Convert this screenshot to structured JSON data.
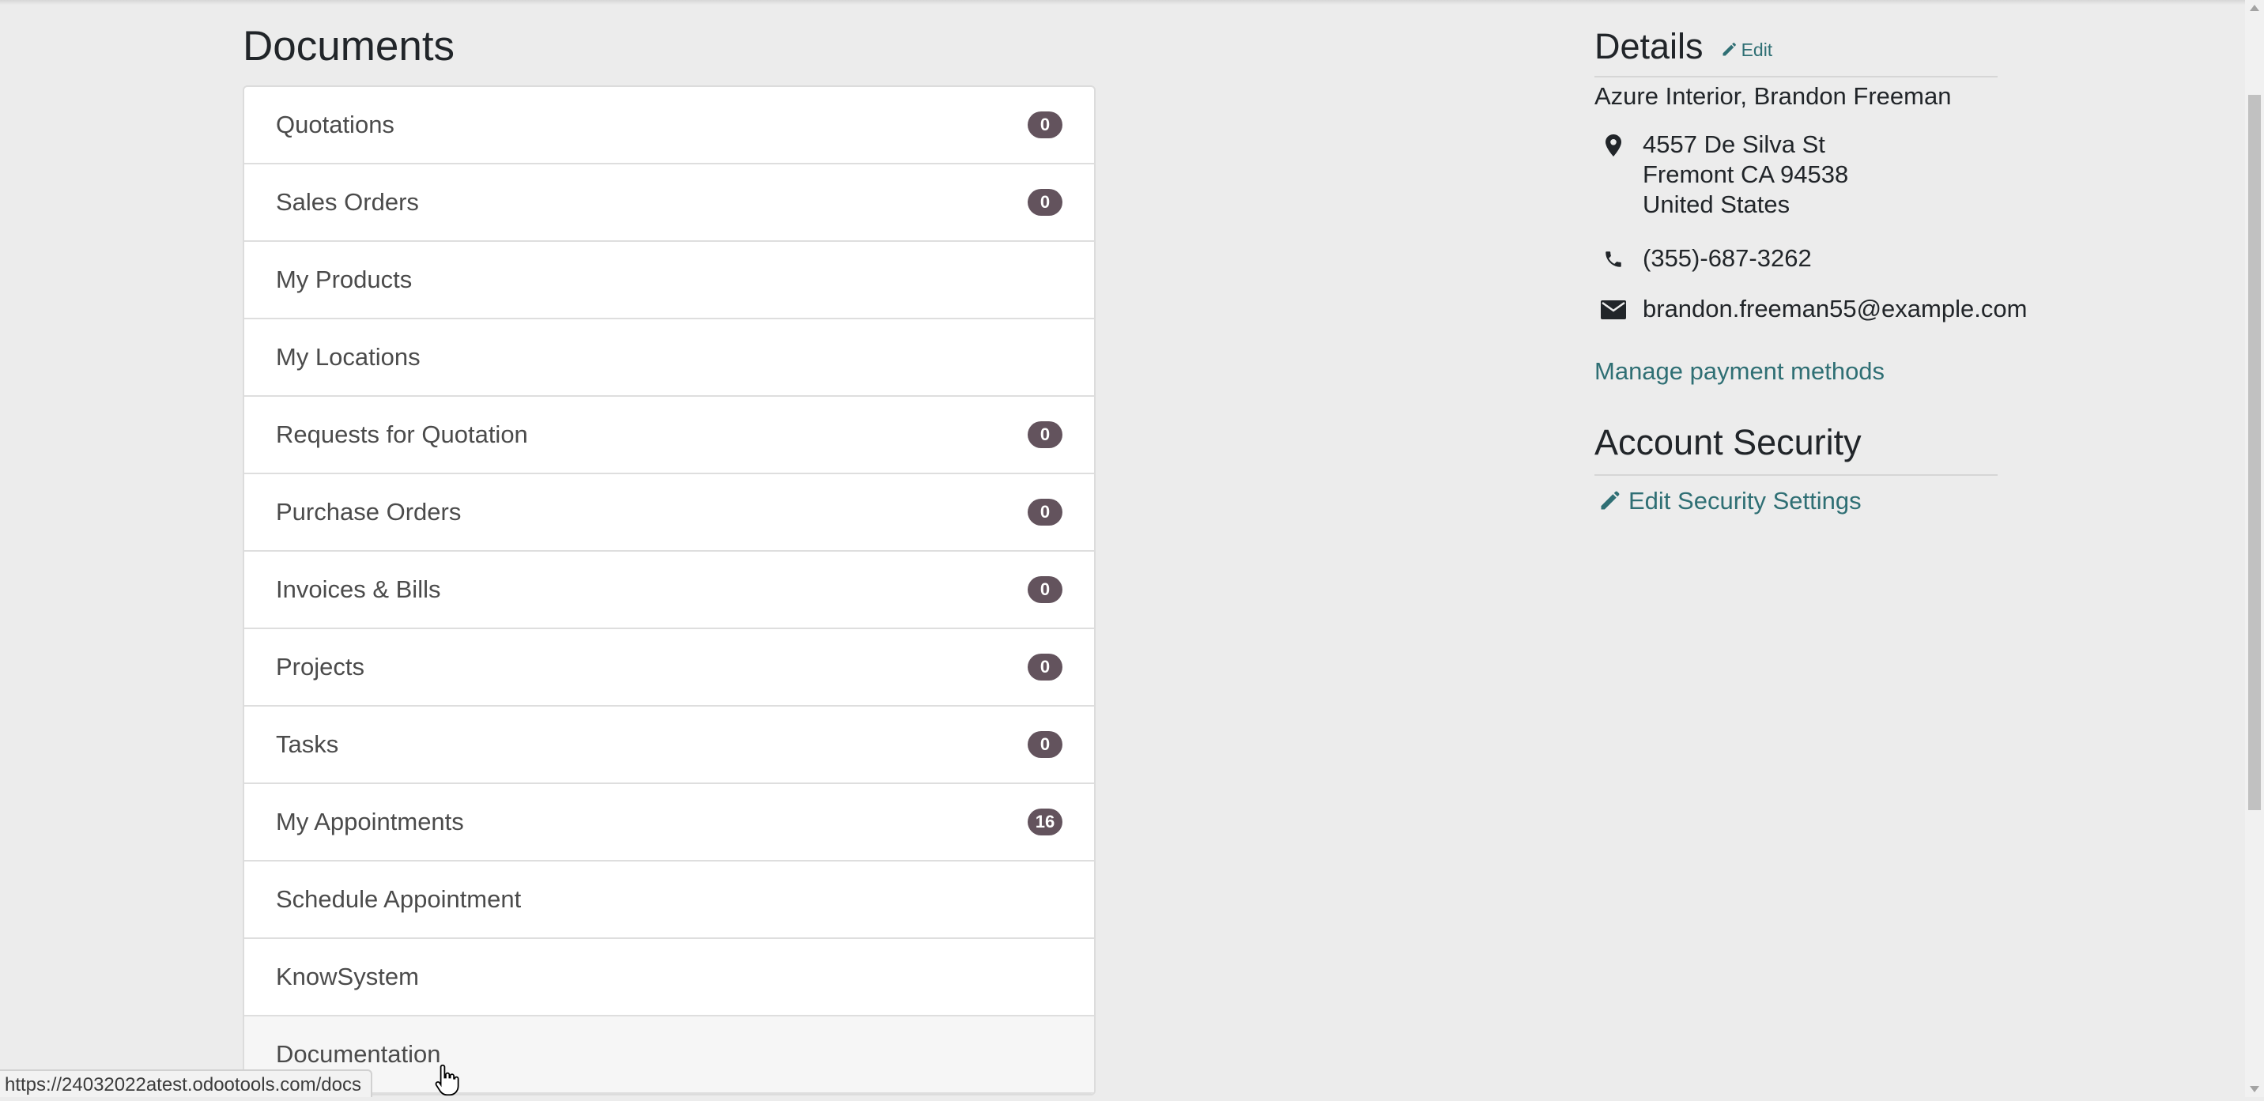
{
  "documents": {
    "title": "Documents",
    "items": [
      {
        "label": "Quotations",
        "badge": "0"
      },
      {
        "label": "Sales Orders",
        "badge": "0"
      },
      {
        "label": "My Products",
        "badge": null
      },
      {
        "label": "My Locations",
        "badge": null
      },
      {
        "label": "Requests for Quotation",
        "badge": "0"
      },
      {
        "label": "Purchase Orders",
        "badge": "0"
      },
      {
        "label": "Invoices & Bills",
        "badge": "0"
      },
      {
        "label": "Projects",
        "badge": "0"
      },
      {
        "label": "Tasks",
        "badge": "0"
      },
      {
        "label": "My Appointments",
        "badge": "16"
      },
      {
        "label": "Schedule Appointment",
        "badge": null
      },
      {
        "label": "KnowSystem",
        "badge": null
      },
      {
        "label": "Documentation",
        "badge": null
      }
    ]
  },
  "details": {
    "title": "Details",
    "edit_label": "Edit",
    "partner_name": "Azure Interior, Brandon Freeman",
    "address_line1": "4557 De Silva St",
    "address_line2": "Fremont CA 94538",
    "address_line3": "United States",
    "phone": "(355)-687-3262",
    "email": "brandon.freeman55@example.com",
    "manage_payment_label": "Manage payment methods"
  },
  "security": {
    "title": "Account Security",
    "edit_label": "Edit Security Settings"
  },
  "status_bar": {
    "url": "https://24032022atest.odootools.com/docs"
  },
  "colors": {
    "accent_link": "#2f6f74",
    "badge_bg": "#63535d",
    "page_bg": "#ececec"
  },
  "icons": {
    "edit": "pencil-icon",
    "address": "map-marker-icon",
    "phone": "phone-icon",
    "email": "envelope-icon"
  }
}
